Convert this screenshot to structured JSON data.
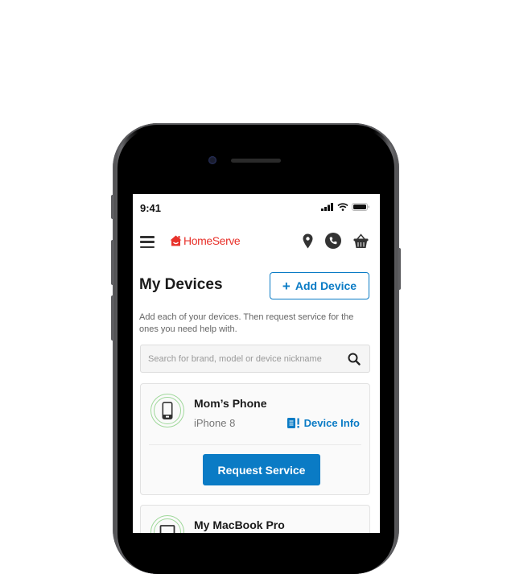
{
  "status_bar": {
    "time": "9:41"
  },
  "navbar": {
    "brand": "HomeServe",
    "icons": [
      "menu-icon",
      "location-pin-icon",
      "phone-icon",
      "basket-icon"
    ]
  },
  "page": {
    "title": "My Devices",
    "add_button_label": "Add Device",
    "description": "Add each of your devices. Then request service for the ones you need help with.",
    "search_placeholder": "Search for brand, model or device nickname"
  },
  "devices": [
    {
      "name": "Mom’s Phone",
      "model": "iPhone 8",
      "info_label": "Device Info",
      "action_label": "Request Service",
      "icon": "smartphone-icon"
    },
    {
      "name": "My MacBook Pro",
      "icon": "laptop-icon"
    }
  ],
  "colors": {
    "brand_red": "#e8322b",
    "accent_blue": "#0a7bc5",
    "ring_green": "#9fd89a"
  }
}
